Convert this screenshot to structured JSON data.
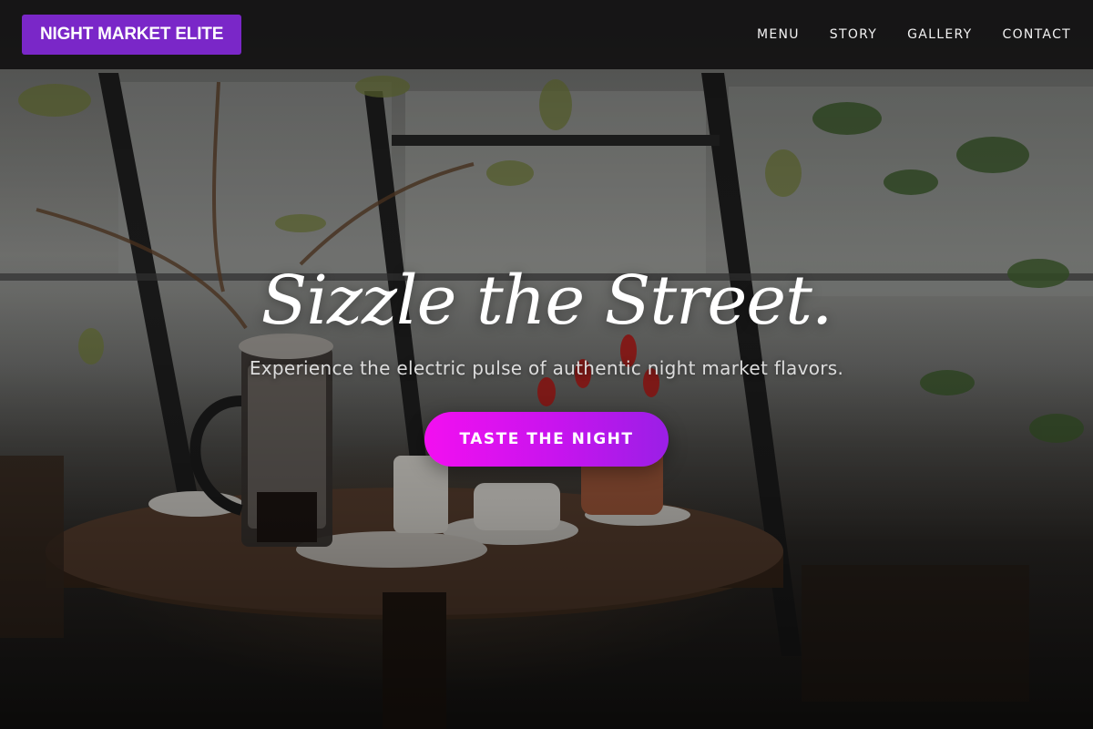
{
  "navbar": {
    "brand": "NIGHT MARKET ELITE",
    "links": [
      "MENU",
      "STORY",
      "GALLERY",
      "CONTACT"
    ]
  },
  "hero": {
    "title": "Sizzle the Street.",
    "subtitle": "Experience the electric pulse of authentic night market flavors.",
    "cta_label": "TASTE THE NIGHT"
  },
  "colors": {
    "brand_bg": "#7a27c8",
    "nav_bg": "#121112",
    "cta_gradient_start": "#f30ff0",
    "cta_gradient_end": "#9a1fe6"
  }
}
